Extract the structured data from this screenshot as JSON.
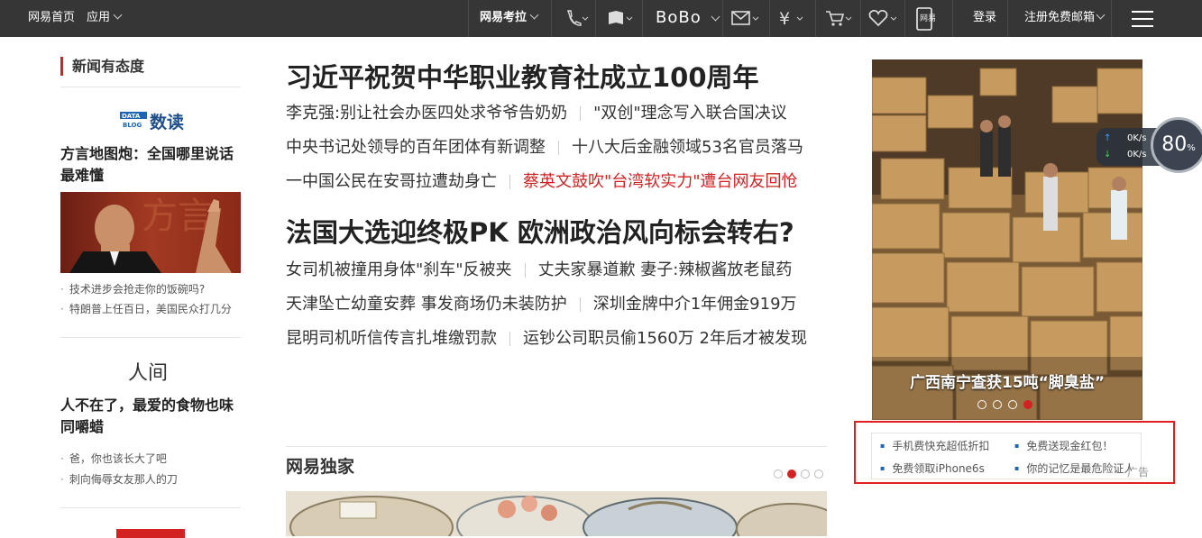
{
  "topbar": {
    "home": "网易首页",
    "apps": "应用",
    "kaola": "网易考拉",
    "bobo": "BoBo",
    "mobile_label": "网易",
    "login": "登录",
    "register": "注册免费邮箱"
  },
  "left": {
    "section_title": "新闻有态度",
    "shudu_brand": "DATA BLOG",
    "shudu_title": "数读",
    "story1_title": "方言地图炮：全国哪里说话最难懂",
    "story1_links": [
      "技术进步会抢走你的饭碗吗?",
      "特朗普上任百日，美国民众打几分"
    ],
    "renjian_title": "人间",
    "story2_title": "人不在了，最爱的食物也味同嚼蜡",
    "story2_links": [
      "爸，你也该长大了吧",
      "刺向侮辱女友那人的刀"
    ]
  },
  "center": {
    "headline1": "习近平祝贺中华职业教育社成立100周年",
    "group1": [
      [
        "李克强:别让社会办医四处求爷爷告奶奶",
        "\"双创\"理念写入联合国决议"
      ],
      [
        "中央书记处领导的百年团体有新调整",
        "十八大后金融领域53名官员落马"
      ],
      [
        "一中国公民在安哥拉遭劫身亡",
        "蔡英文鼓吹\"台湾软实力\"遭台网友回怆"
      ]
    ],
    "headline2": "法国大选迎终极PK 欧洲政治风向标会转右?",
    "group2": [
      [
        "女司机被撞用身体\"刹车\"反被夹",
        "丈夫家暴道歉 妻子:辣椒酱放老鼠药"
      ],
      [
        "天津坠亡幼童安葬 事发商场仍未装防护",
        "深圳金牌中介1年佣金919万"
      ],
      [
        "昆明司机听信传言扎堆缴罚款",
        "运钞公司职员偷1560万 2年后才被发现"
      ]
    ],
    "dujia_title": "网易独家"
  },
  "right": {
    "photo_caption": "广西南宁查获15吨“脚臭盐”",
    "netspeed_up": "0K/s",
    "netspeed_down": "0K/s",
    "netspeed_pct": "80",
    "netspeed_unit": "%",
    "ads": [
      "手机费快充超低折扣",
      "免费送现金红包！",
      "免费领取iPhone6s",
      "你的记忆是最危险证人"
    ],
    "ad_mark": "广告"
  },
  "colors": {
    "topbar_bg": "#363636",
    "accent_red": "#d22222",
    "highlight_box": "#e02020"
  }
}
